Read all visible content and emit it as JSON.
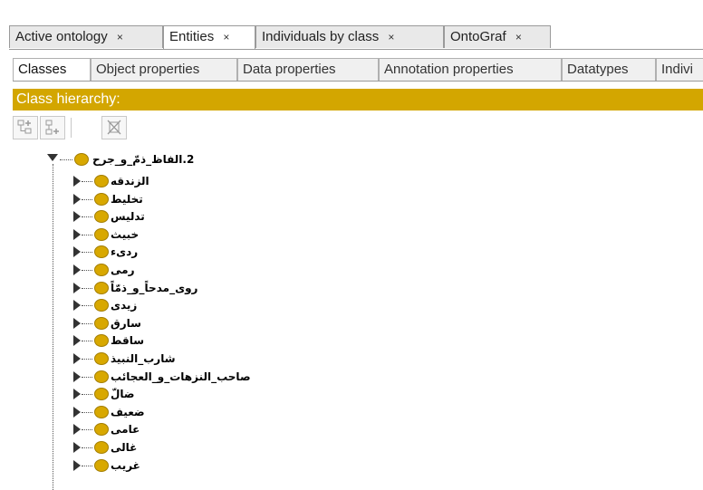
{
  "tabs": [
    {
      "label": "Active ontology",
      "close": "×"
    },
    {
      "label": "Entities",
      "close": "×"
    },
    {
      "label": "Individuals by class",
      "close": "×"
    },
    {
      "label": "OntoGraf",
      "close": "×"
    }
  ],
  "subtabs": [
    "Classes",
    "Object properties",
    "Data properties",
    "Annotation properties",
    "Datatypes",
    "Indivi"
  ],
  "hierarchy": {
    "title": "Class hierarchy:"
  },
  "toolbar": {
    "icons": [
      "add-subclass-icon",
      "add-sibling-icon",
      "delete-class-icon"
    ]
  },
  "tree": {
    "root": {
      "label": "2.الفاظ_ذمّ_و_جرح"
    },
    "children": [
      "الزندقه",
      "تخليط",
      "تدليس",
      "خبيث",
      "ردیء",
      "رمی",
      "روی_مدحاً_و_ذمّاً",
      "زيدی",
      "سارق",
      "ساقط",
      "شارب_النبيذ",
      "صاحب_النزهات_و_العجائب",
      "ضالّ",
      "ضعيف",
      "عامی",
      "غالی",
      "غريب"
    ]
  },
  "colors": {
    "header_bg": "#d3a600",
    "class_dot": "#d8a800"
  }
}
